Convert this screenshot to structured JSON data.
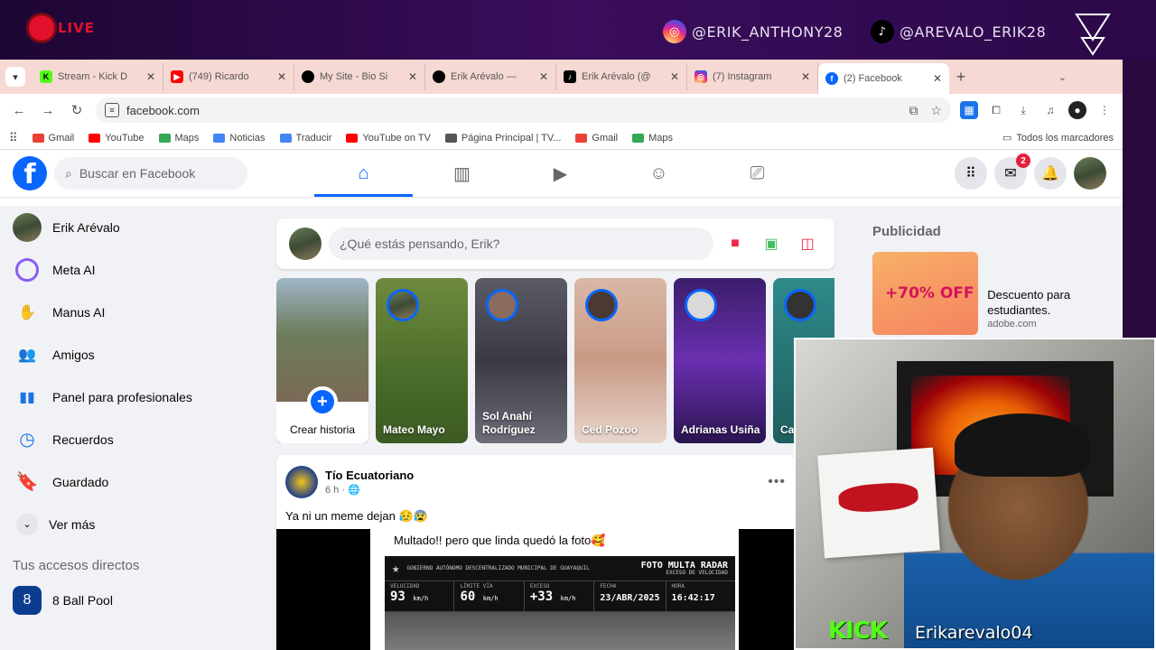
{
  "stream": {
    "live_label": "LIVE",
    "instagram_handle": "@ERIK_ANTHONY28",
    "tiktok_handle": "@AREVALO_ERIK28",
    "kick_logo": "KICK",
    "kick_username": "Erikarevalo04"
  },
  "browser": {
    "tabs": [
      {
        "title": "Stream - Kick D",
        "icon": "kick-icon",
        "color": "#53fc18"
      },
      {
        "title": "(749) Ricardo",
        "icon": "youtube-icon",
        "color": "#ff0000"
      },
      {
        "title": "My Site - Bio Si",
        "icon": "mysite-icon",
        "color": "#000000"
      },
      {
        "title": "Erik Arévalo —",
        "icon": "mysite-icon",
        "color": "#000000"
      },
      {
        "title": "Erik Arévalo (@",
        "icon": "tiktok-icon",
        "color": "#000000"
      },
      {
        "title": "(7) Instagram",
        "icon": "instagram-icon",
        "color": "#d6249f"
      },
      {
        "title": "(2) Facebook",
        "icon": "facebook-icon",
        "color": "#0866ff",
        "active": true
      }
    ],
    "url": "facebook.com",
    "bookmarks": [
      {
        "label": "Gmail",
        "color": "#ea4335"
      },
      {
        "label": "YouTube",
        "color": "#ff0000"
      },
      {
        "label": "Maps",
        "color": "#34a853"
      },
      {
        "label": "Noticias",
        "color": "#4285f4"
      },
      {
        "label": "Traducir",
        "color": "#4285f4"
      },
      {
        "label": "YouTube on TV",
        "color": "#ff0000"
      },
      {
        "label": "Página Principal | TV...",
        "color": "#555555"
      },
      {
        "label": "Gmail",
        "color": "#ea4335"
      },
      {
        "label": "Maps",
        "color": "#34a853"
      }
    ],
    "all_bookmarks": "Todos los marcadores"
  },
  "fb": {
    "search_placeholder": "Buscar en Facebook",
    "messenger_badge": "2",
    "left_nav": [
      {
        "label": "Erik Arévalo",
        "icon": "profile-avatar"
      },
      {
        "label": "Meta AI",
        "icon": "meta-ai-icon"
      },
      {
        "label": "Manus AI",
        "icon": "manus-ai-icon"
      },
      {
        "label": "Amigos",
        "icon": "friends-icon"
      },
      {
        "label": "Panel para profesionales",
        "icon": "dashboard-icon"
      },
      {
        "label": "Recuerdos",
        "icon": "memories-icon"
      },
      {
        "label": "Guardado",
        "icon": "saved-icon"
      }
    ],
    "see_more": "Ver más",
    "shortcuts_title": "Tus accesos directos",
    "shortcuts": [
      {
        "label": "8 Ball Pool",
        "icon": "8-ball-pool-icon"
      }
    ],
    "composer_placeholder": "¿Qué estás pensando, Erik?",
    "create_story": "Crear historia",
    "stories": [
      {
        "name": "Mateo Mayo"
      },
      {
        "name": "Sol Anahí Rodríguez"
      },
      {
        "name": "Ced Pozoo"
      },
      {
        "name": "Adrianas Usiña"
      },
      {
        "name": "Car"
      }
    ],
    "post": {
      "author": "Tío Ecuatoriano",
      "time": "6 h ·",
      "text": "Ya ni un meme dejan 😥😰",
      "meme_caption": "Multado!! pero que linda quedó la foto🥰",
      "radar_title": "FOTO MULTA RADAR",
      "radar_subtitle": "EXCESO DE VELOCIDAD",
      "radar_header_left": "GOBIERNO AUTÓNOMO DESCENTRALIZADO MUNICIPAL DE GUAYAQUIL",
      "cells": [
        {
          "label": "VELOCIDAD",
          "value": "93",
          "unit": "km/h"
        },
        {
          "label": "LÍMITE VÍA",
          "value": "60",
          "unit": "km/h"
        },
        {
          "label": "EXCESO",
          "value": "+33",
          "unit": "km/h"
        },
        {
          "label": "FECHA",
          "value": "23/ABR/2025",
          "unit": ""
        },
        {
          "label": "HORA",
          "value": "16:42:17",
          "unit": ""
        }
      ]
    },
    "ad": {
      "section_title": "Publicidad",
      "offer": "+70% OFF",
      "text": "Descuento para estudiantes.",
      "url": "adobe.com"
    }
  }
}
